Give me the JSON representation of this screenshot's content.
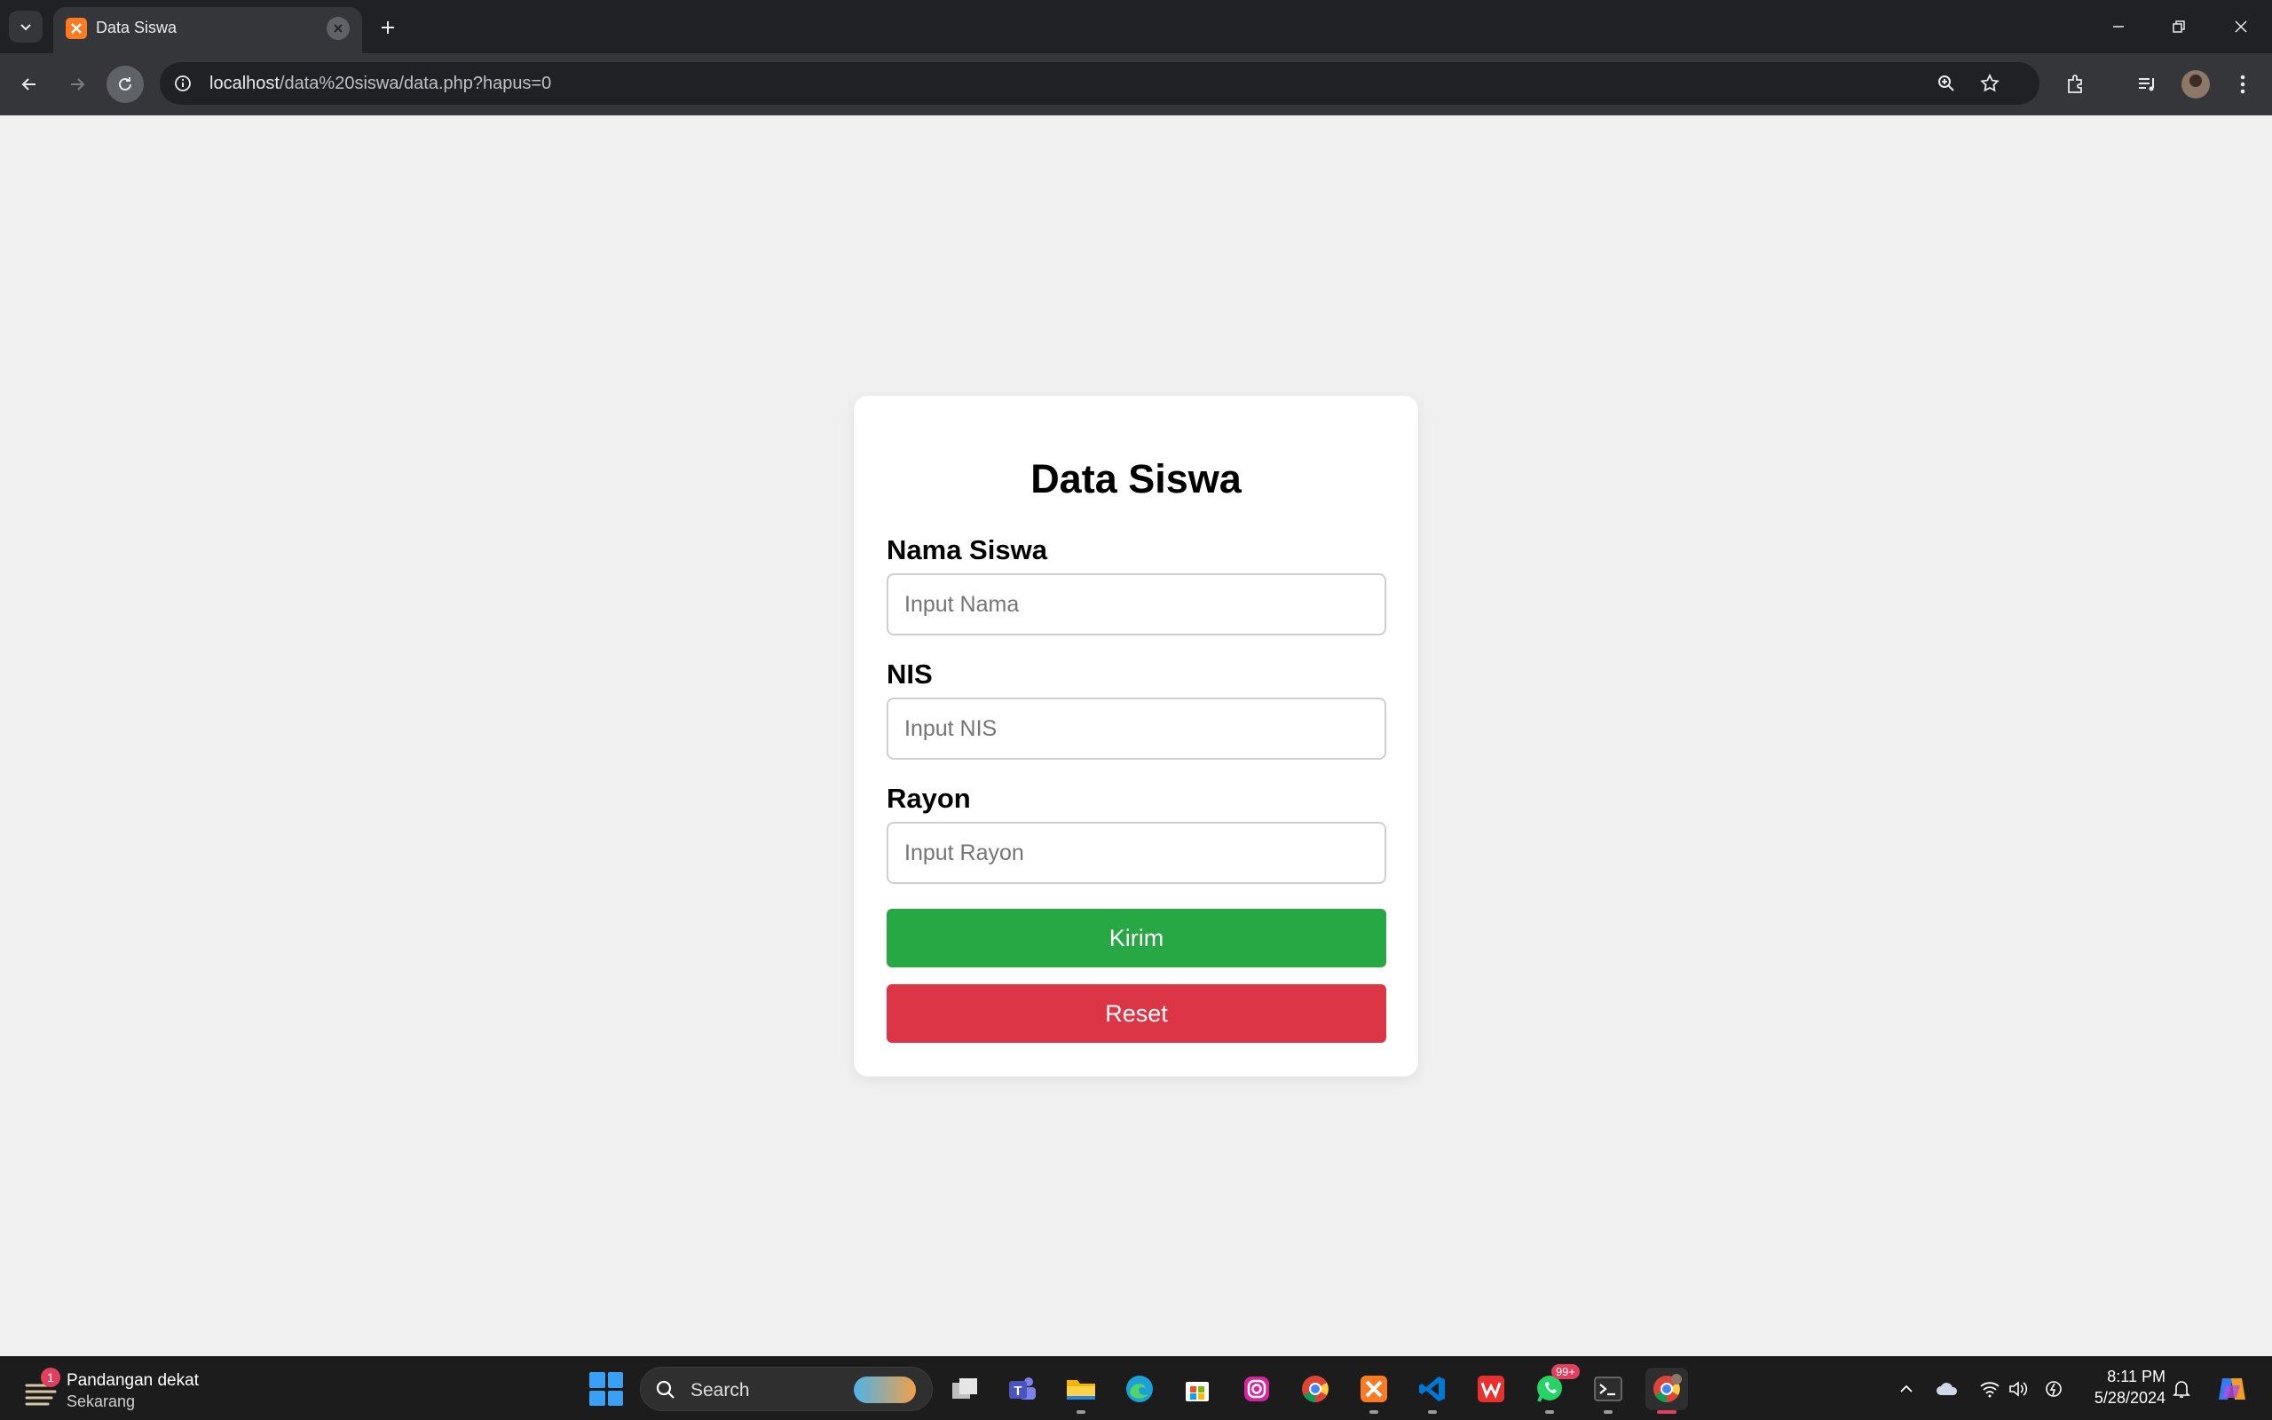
{
  "browser": {
    "tab": {
      "title": "Data Siswa"
    },
    "address": {
      "host": "localhost",
      "path": "/data%20siswa/data.php?hapus=0"
    }
  },
  "form": {
    "title": "Data Siswa",
    "fields": [
      {
        "label": "Nama Siswa",
        "placeholder": "Input Nama",
        "value": ""
      },
      {
        "label": "NIS",
        "placeholder": "Input NIS",
        "value": ""
      },
      {
        "label": "Rayon",
        "placeholder": "Input Rayon",
        "value": ""
      }
    ],
    "submit_label": "Kirim",
    "reset_label": "Reset",
    "colors": {
      "submit": "#28a745",
      "reset": "#dc3545"
    }
  },
  "taskbar": {
    "weather": {
      "title": "Pandangan dekat",
      "subtitle": "Sekarang",
      "badge": "1"
    },
    "search_label": "Search",
    "whatsapp_badge": "99+",
    "clock": {
      "time": "8:11 PM",
      "date": "5/28/2024"
    },
    "apps": [
      "task-view",
      "teams",
      "file-explorer",
      "edge",
      "microsoft-store",
      "instagram",
      "chrome",
      "xampp",
      "vscode",
      "wps-office",
      "whatsapp",
      "terminal",
      "chrome-profile"
    ]
  }
}
